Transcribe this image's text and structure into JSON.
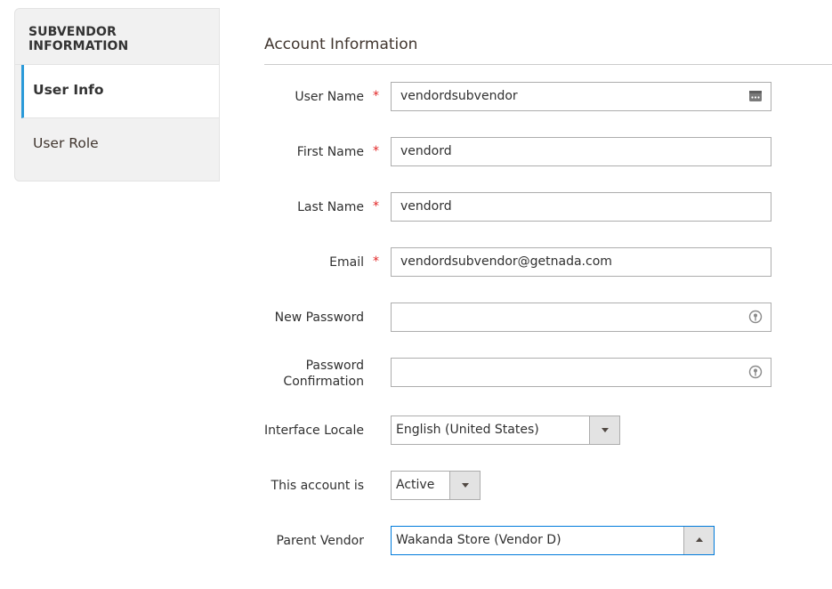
{
  "sidebar": {
    "title": "SUBVENDOR INFORMATION",
    "items": [
      {
        "label": "User Info",
        "active": true
      },
      {
        "label": "User Role",
        "active": false
      }
    ]
  },
  "section": {
    "title": "Account Information"
  },
  "form": {
    "username": {
      "label": "User Name",
      "value": "vendordsubvendor",
      "required": true,
      "icon": "password-manager-icon"
    },
    "firstname": {
      "label": "First Name",
      "value": "vendord",
      "required": true
    },
    "lastname": {
      "label": "Last Name",
      "value": "vendord",
      "required": true
    },
    "email": {
      "label": "Email",
      "value": "vendordsubvendor@getnada.com",
      "required": true
    },
    "new_password": {
      "label": "New Password",
      "value": "",
      "icon": "key-icon"
    },
    "password_confirmation": {
      "label_line1": "Password",
      "label_line2": "Confirmation",
      "value": "",
      "icon": "key-icon"
    },
    "interface_locale": {
      "label": "Interface Locale",
      "selected": "English (United States)"
    },
    "account_status": {
      "label": "This account is",
      "selected": "Active"
    },
    "parent_vendor": {
      "label": "Parent Vendor",
      "selected": "Wakanda Store (Vendor D)"
    }
  },
  "colors": {
    "accent": "#2a9ad9",
    "required": "#e22626",
    "focus": "#007bdb"
  }
}
